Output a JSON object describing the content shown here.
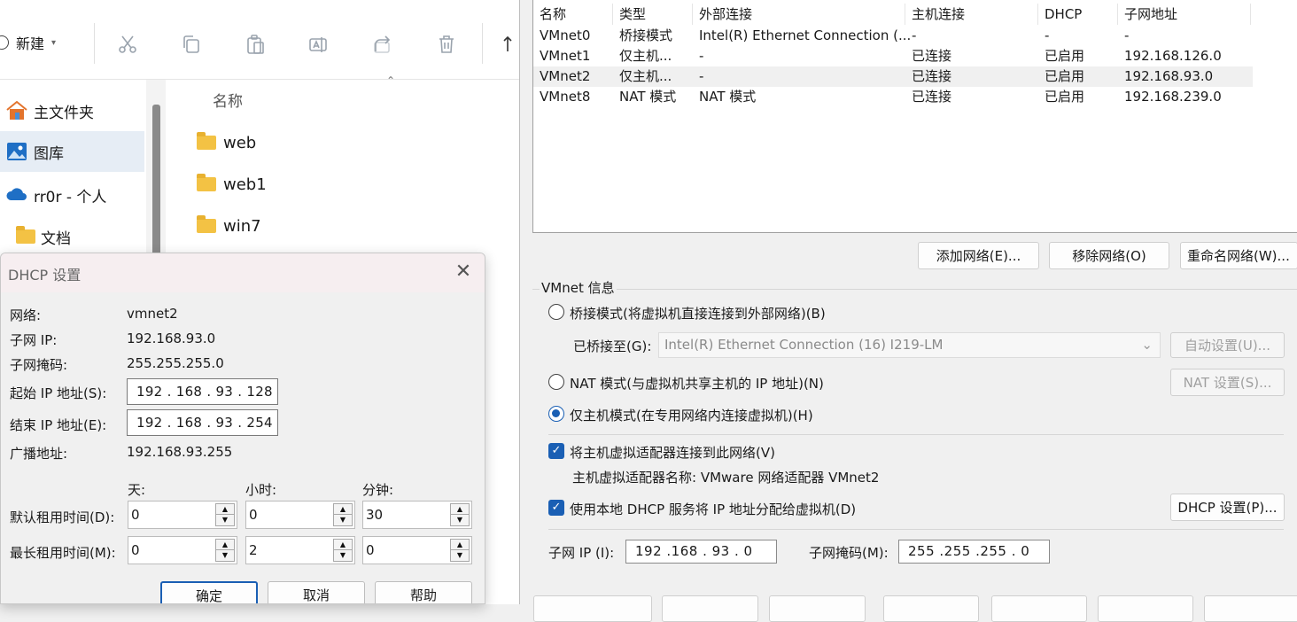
{
  "explorer": {
    "new_label": "新建",
    "toolbar_icons": [
      "cut-icon",
      "copy-icon",
      "paste-icon",
      "rename-icon",
      "share-icon",
      "delete-icon",
      "sort-icon"
    ],
    "nav": [
      {
        "label": "主文件夹",
        "icon": "home-icon"
      },
      {
        "label": "图库",
        "icon": "gallery-icon"
      },
      {
        "label": "rr0r - 个人",
        "icon": "onedrive-cloud-icon"
      },
      {
        "label": "文档",
        "icon": "folder-icon"
      }
    ],
    "column_name": "名称",
    "files": [
      "web",
      "web1",
      "win7"
    ]
  },
  "vne": {
    "table": {
      "headers": [
        "名称",
        "类型",
        "外部连接",
        "主机连接",
        "DHCP",
        "子网地址"
      ],
      "rows": [
        [
          "VMnet0",
          "桥接模式",
          "Intel(R) Ethernet Connection (...",
          "-",
          "-",
          "-"
        ],
        [
          "VMnet1",
          "仅主机...",
          "-",
          "已连接",
          "已启用",
          "192.168.126.0"
        ],
        [
          "VMnet2",
          "仅主机...",
          "-",
          "已连接",
          "已启用",
          "192.168.93.0"
        ],
        [
          "VMnet8",
          "NAT 模式",
          "NAT 模式",
          "已连接",
          "已启用",
          "192.168.239.0"
        ]
      ],
      "selected_row": 2
    },
    "buttons": {
      "add": "添加网络(E)...",
      "remove": "移除网络(O)",
      "rename": "重命名网络(W)..."
    },
    "info": {
      "group_title": "VMnet 信息",
      "bridged": "桥接模式(将虚拟机直接连接到外部网络)(B)",
      "bridged_to_label": "已桥接至(G):",
      "bridged_to_value": "Intel(R) Ethernet Connection (16) I219-LM",
      "auto_settings": "自动设置(U)...",
      "nat": "NAT 模式(与虚拟机共享主机的 IP 地址)(N)",
      "nat_settings": "NAT 设置(S)...",
      "host_only": "仅主机模式(在专用网络内连接虚拟机)(H)",
      "mode_selected": "host_only",
      "connect_adapter": "将主机虚拟适配器连接到此网络(V)",
      "connect_adapter_checked": true,
      "adapter_name": "主机虚拟适配器名称: VMware 网络适配器 VMnet2",
      "use_dhcp": "使用本地 DHCP 服务将 IP 地址分配给虚拟机(D)",
      "use_dhcp_checked": true,
      "dhcp_settings": "DHCP 设置(P)...",
      "subnet_ip_label": "子网 IP (I):",
      "subnet_ip": "192 .168 . 93 .  0",
      "subnet_mask_label": "子网掩码(M):",
      "subnet_mask": "255 .255 .255 .  0"
    }
  },
  "dhcp": {
    "title": "DHCP 设置",
    "network_label": "网络:",
    "network": "vmnet2",
    "subnet_ip_label": "子网 IP:",
    "subnet_ip": "192.168.93.0",
    "subnet_mask_label": "子网掩码:",
    "subnet_mask": "255.255.255.0",
    "start_ip_label": "起始 IP 地址(S):",
    "start_ip": "192 . 168 .  93  . 128",
    "end_ip_label": "结束 IP 地址(E):",
    "end_ip": "192 . 168 .  93  . 254",
    "broadcast_label": "广播地址:",
    "broadcast": "192.168.93.255",
    "col_days": "天:",
    "col_hours": "小时:",
    "col_minutes": "分钟:",
    "default_lease_label": "默认租用时间(D):",
    "default_lease": [
      "0",
      "0",
      "30"
    ],
    "max_lease_label": "最长租用时间(M):",
    "max_lease": [
      "0",
      "2",
      "0"
    ],
    "ok": "确定",
    "cancel": "取消",
    "help": "帮助"
  }
}
